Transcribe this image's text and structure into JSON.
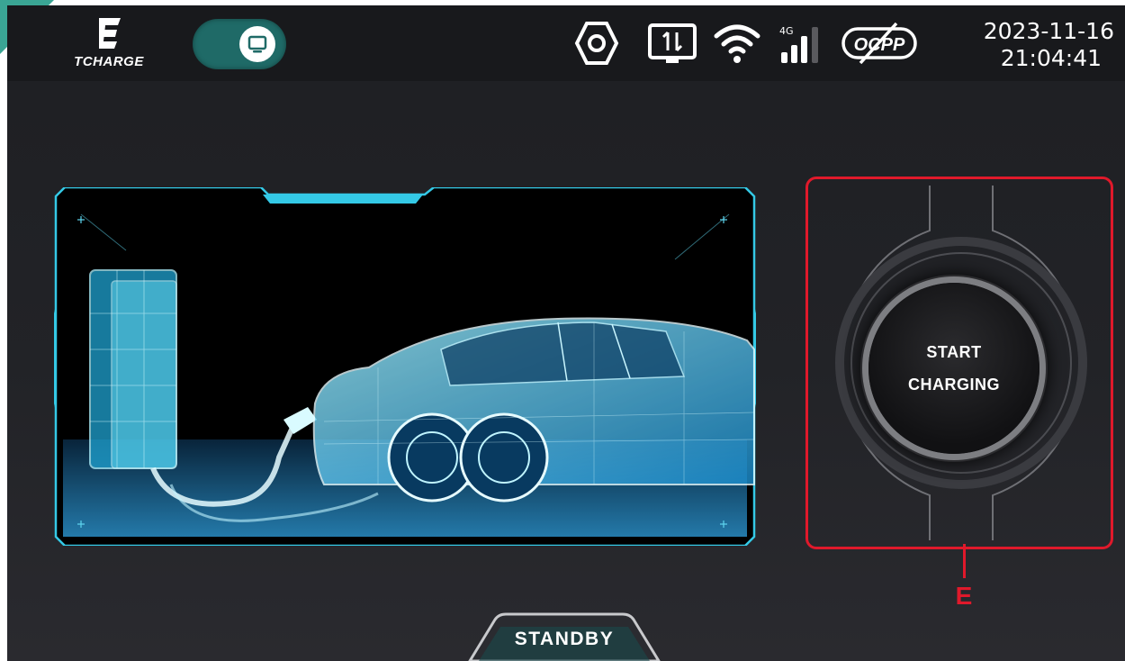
{
  "brand": {
    "name": "TCHARGE"
  },
  "header": {
    "mode_toggle": {
      "icon": "screen-icon",
      "state": "on"
    },
    "status_icons": [
      "settings-hex-icon",
      "data-transfer-icon",
      "wifi-icon",
      "4g-signal-icon",
      "ocpp-disabled-icon"
    ],
    "signal_label": "4G",
    "ocpp_label": "OCPP",
    "date": "2023-11-16",
    "time": "21:04:41"
  },
  "main": {
    "start_button": {
      "line1": "START",
      "line2": "CHARGING"
    },
    "callout_label": "E",
    "status_tab": "STANDBY"
  },
  "colors": {
    "accent": "#1f6a67",
    "panel_glow": "#34c9e6",
    "callout": "#e0192b",
    "corner": "#3aa594"
  }
}
